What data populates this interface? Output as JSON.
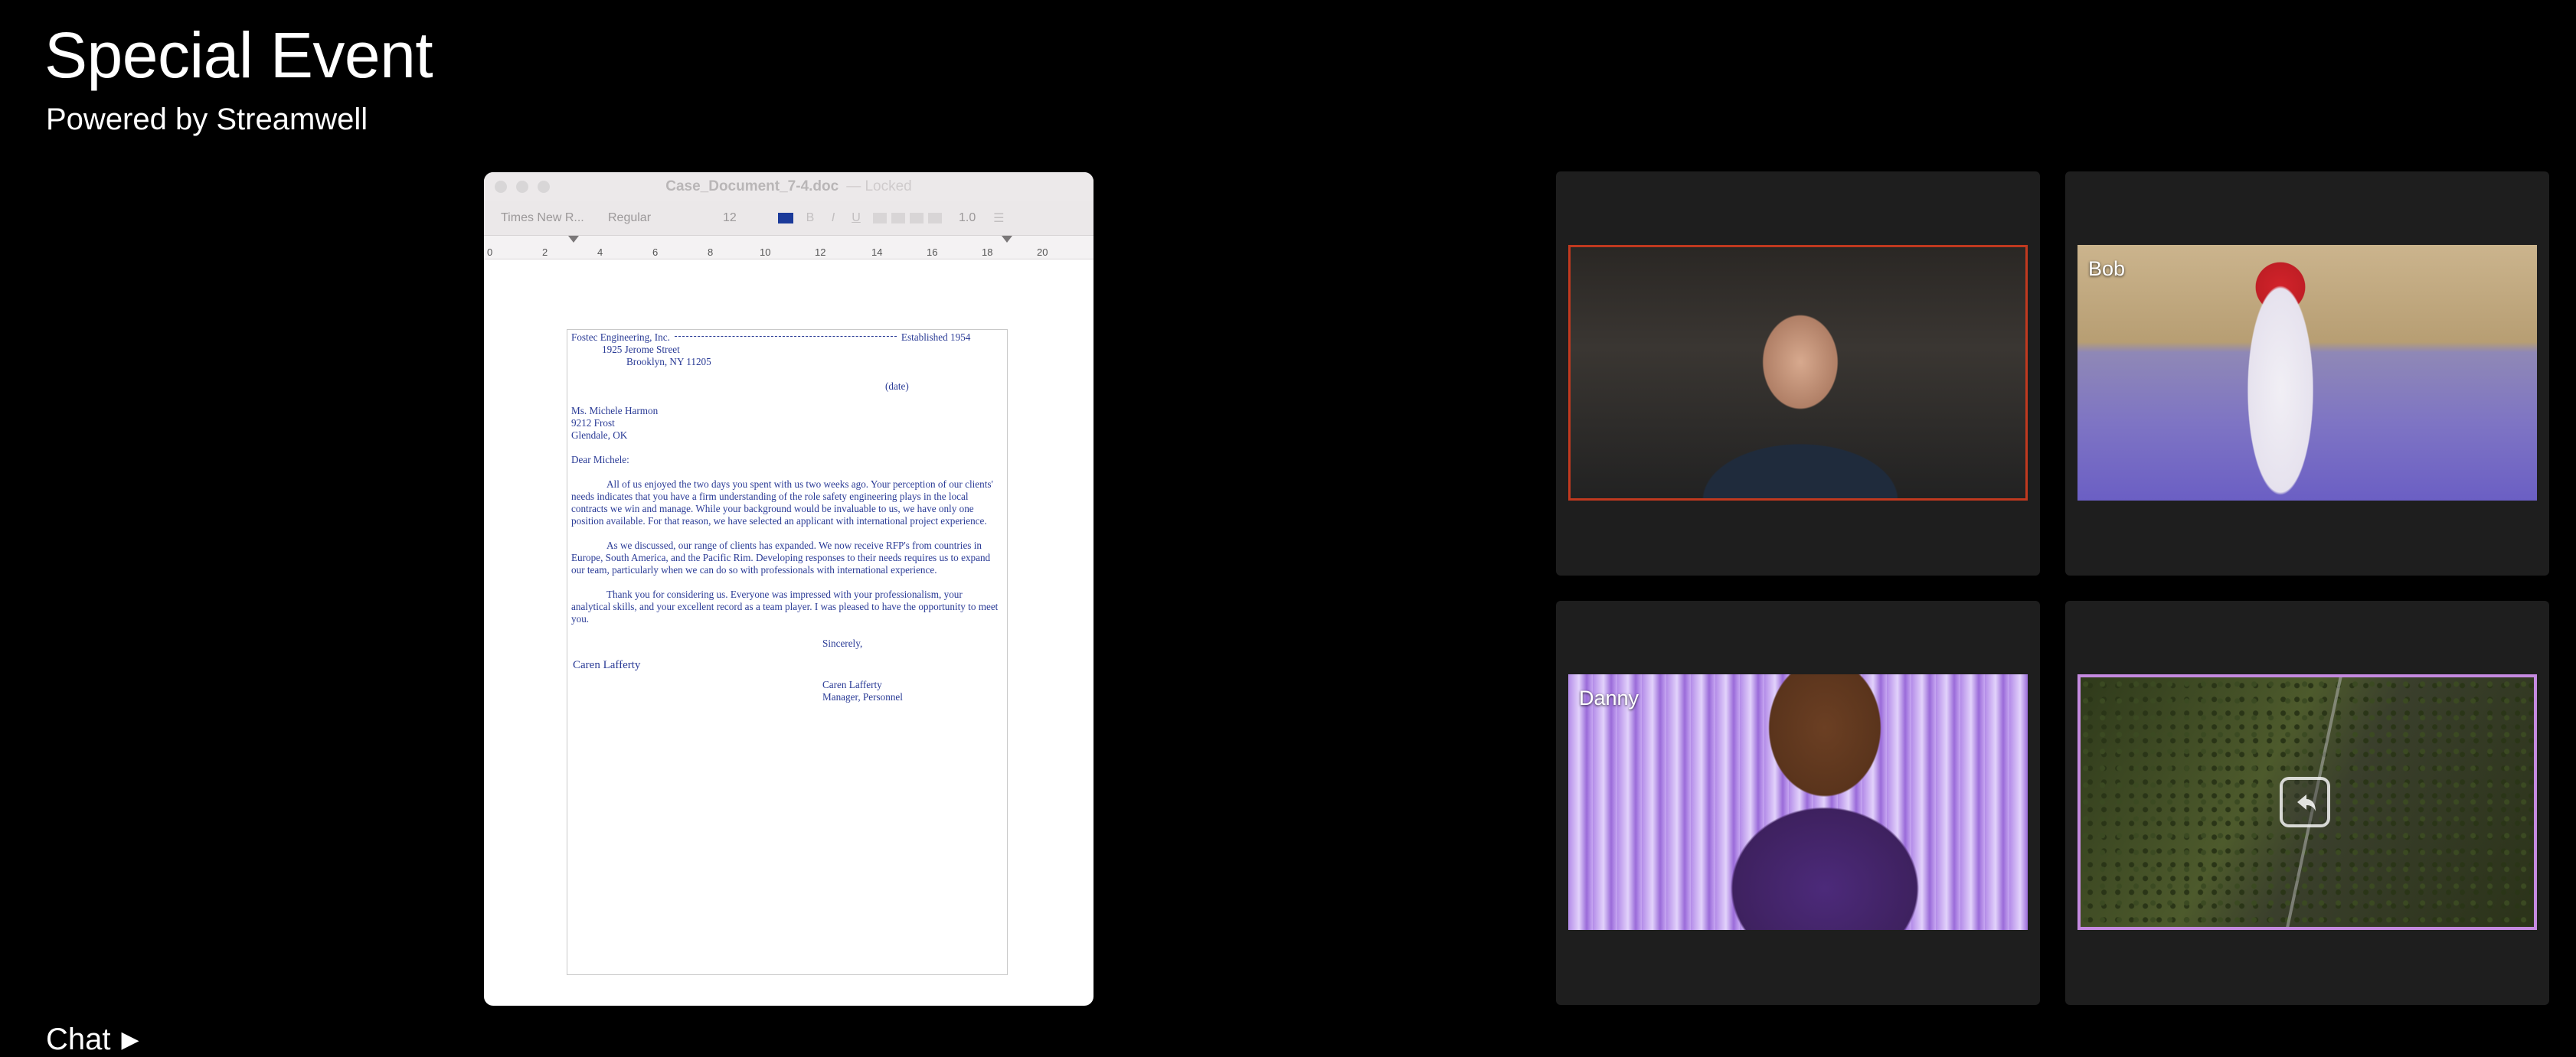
{
  "header": {
    "title": "Special Event",
    "subtitle": "Powered by Streamwell"
  },
  "chat": {
    "label": "Chat"
  },
  "shared_screen": {
    "window_title": "Case_Document_7-4.doc",
    "window_status": "— Locked",
    "toolbar": {
      "font": "Times New R...",
      "style": "Regular",
      "size": "12",
      "spacing": "1.0"
    },
    "ruler_ticks": [
      "0",
      "2",
      "4",
      "6",
      "8",
      "10",
      "12",
      "14",
      "16",
      "18",
      "20"
    ],
    "document": {
      "company": "Fostec Engineering, Inc.",
      "established": "Established 1954",
      "street": "1925 Jerome Street",
      "city": "Brooklyn, NY 11205",
      "date": "(date)",
      "recipient_name": "Ms. Michele Harmon",
      "recipient_street": "9212 Frost",
      "recipient_city": "Glendale, OK",
      "salutation": "Dear Michele:",
      "paragraph1": "All of us enjoyed the two days you spent with us two weeks ago. Your perception of our clients' needs indicates that you have a firm understanding of the role safety engineering plays in the local contracts we win and manage. While your background would be invaluable to us, we have only one position available. For that reason, we have selected an applicant with international project experience.",
      "paragraph2": "As we discussed, our range of clients has expanded. We now receive RFP's from countries in Europe, South America, and the Pacific Rim. Developing responses to their needs requires us to expand our team, particularly when we can do so with professionals with international experience.",
      "paragraph3": "Thank you for considering us. Everyone was impressed with your professionalism, your analytical skills, and your excellent record as a team player. I was pleased to have the opportunity to meet you.",
      "closing": "Sincerely,",
      "signature": "Caren Lafferty",
      "signer_name": "Caren Lafferty",
      "signer_title": "Manager, Personnel"
    }
  },
  "participants": [
    {
      "name": "",
      "active_speaker": true,
      "border_color": "#c0391f"
    },
    {
      "name": "Bob"
    },
    {
      "name": "Danny"
    },
    {
      "name": "",
      "screen_share": true,
      "border_color": "#c58ae0",
      "icon": "screen-share-icon"
    }
  ]
}
